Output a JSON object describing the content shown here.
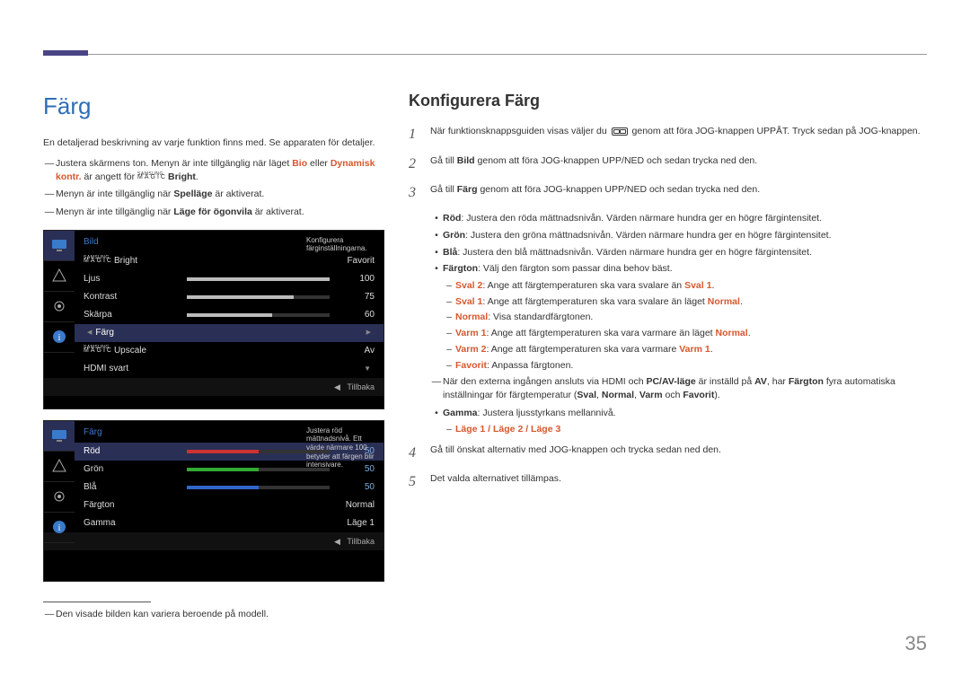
{
  "page_number": "35",
  "left": {
    "title": "Färg",
    "intro": "En detaljerad beskrivning av varje funktion finns med. Se apparaten för detaljer.",
    "fn1_pre": "Justera skärmens ton. Menyn är inte tillgänglig när läget ",
    "fn1_bio": "Bio",
    "fn1_mid": " eller ",
    "fn1_dyn": "Dynamisk kontr.",
    "fn1_post1": " är angett för ",
    "fn1_brand": "Bright",
    "fn1_end": ".",
    "fn2_pre": "Menyn är inte tillgänglig när ",
    "fn2_bold": "Spelläge",
    "fn2_post": " är aktiverat.",
    "fn3_pre": "Menyn är inte tillgänglig när ",
    "fn3_bold": "Läge för ögonvila",
    "fn3_post": " är aktiverat.",
    "footnote": "Den visade bilden kan variera beroende på modell."
  },
  "osd1": {
    "title": "Bild",
    "hint": "Konfigurera färginställningarna.",
    "rows": {
      "magic_bright": "Bright",
      "magic_bright_val": "Favorit",
      "ljus": "Ljus",
      "ljus_val": "100",
      "kontrast": "Kontrast",
      "kontrast_val": "75",
      "skarpa": "Skärpa",
      "skarpa_val": "60",
      "farg": "Färg",
      "upscale": "Upscale",
      "upscale_val": "Av",
      "hdmi": "HDMI svart"
    },
    "back": "Tillbaka"
  },
  "osd2": {
    "title": "Färg",
    "hint": "Justera röd mättnadsnivå. Ett värde närmare 100 betyder att färgen blir intensivare.",
    "rows": {
      "rod": "Röd",
      "rod_val": "50",
      "gron": "Grön",
      "gron_val": "50",
      "bla": "Blå",
      "bla_val": "50",
      "fargton": "Färgton",
      "fargton_val": "Normal",
      "gamma": "Gamma",
      "gamma_val": "Läge 1"
    },
    "back": "Tillbaka"
  },
  "right": {
    "title": "Konfigurera Färg",
    "step1_a": "När funktionsknappsguiden visas väljer du ",
    "step1_b": " genom att föra JOG-knappen UPPÅT. Tryck sedan på JOG-knappen.",
    "step2_a": "Gå till ",
    "step2_bold": "Bild",
    "step2_b": " genom att föra JOG-knappen UPP/NED och sedan trycka ned den.",
    "step3_a": "Gå till ",
    "step3_bold": "Färg",
    "step3_b": " genom att föra JOG-knappen UPP/NED och sedan trycka ned den.",
    "bul_rod_h": "Röd",
    "bul_rod_t": ": Justera den röda mättnadsnivån. Värden närmare hundra ger en högre färgintensitet.",
    "bul_gron_h": "Grön",
    "bul_gron_t": ": Justera den gröna mättnadsnivån. Värden närmare hundra ger en högre färgintensitet.",
    "bul_bla_h": "Blå",
    "bul_bla_t": ": Justera den blå mättnadsnivån. Värden närmare hundra ger en högre färgintensitet.",
    "bul_fargton_h": "Färgton",
    "bul_fargton_t": ": Välj den färgton som passar dina behov bäst.",
    "sub_sval2_h": "Sval 2",
    "sub_sval2_t": ": Ange att färgtemperaturen ska vara svalare än ",
    "sub_sval2_e": "Sval 1",
    "sub_sval1_h": "Sval 1",
    "sub_sval1_t": ": Ange att färgtemperaturen ska vara svalare än läget ",
    "sub_sval1_e": "Normal",
    "sub_normal_h": "Normal",
    "sub_normal_t": ": Visa standardfärgtonen.",
    "sub_varm1_h": "Varm 1",
    "sub_varm1_t": ": Ange att färgtemperaturen ska vara varmare än läget ",
    "sub_varm1_e": "Normal",
    "sub_varm2_h": "Varm 2",
    "sub_varm2_t": ": Ange att färgtemperaturen ska vara varmare ",
    "sub_varm2_e": "Varm 1",
    "sub_fav_h": "Favorit",
    "sub_fav_t": ": Anpassa färgtonen.",
    "hdmi_note_a": "När den externa ingången ansluts via HDMI och ",
    "hdmi_note_b": "PC/AV-läge",
    "hdmi_note_c": " är inställd på ",
    "hdmi_note_d": "AV",
    "hdmi_note_e": ", har ",
    "hdmi_note_f": "Färgton",
    "hdmi_note_g": " fyra automatiska inställningar för färgtemperatur (",
    "hdmi_note_h": "Sval",
    "hdmi_note_i": "Normal",
    "hdmi_note_j": "Varm",
    "hdmi_note_k": " och ",
    "hdmi_note_l": "Favorit",
    "hdmi_note_m": ").",
    "bul_gamma_h": "Gamma",
    "bul_gamma_t": ": Justera ljusstyrkans mellannivå.",
    "sub_gamma": "Läge 1 / Läge 2 / Läge 3",
    "step4": "Gå till önskat alternativ med JOG-knappen och trycka sedan ned den.",
    "step5": "Det valda alternativet tillämpas."
  }
}
